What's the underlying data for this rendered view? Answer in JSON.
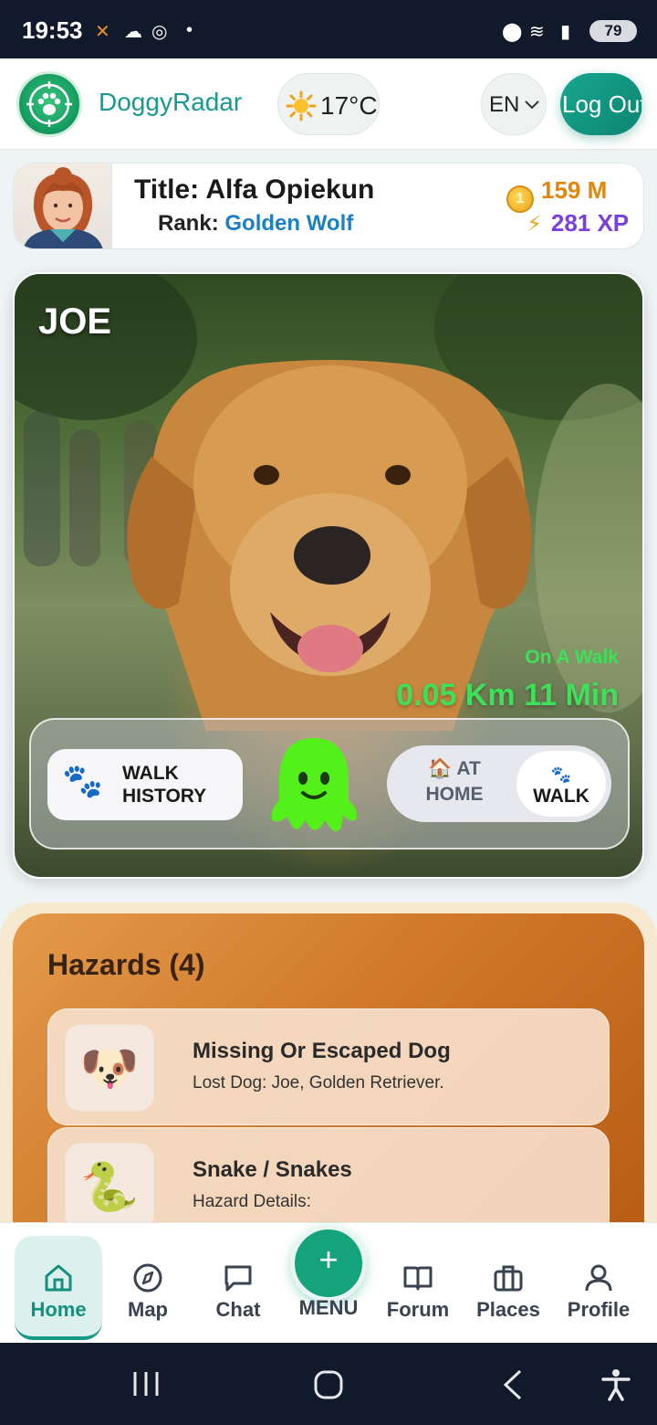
{
  "status_bar": {
    "time": "19:53",
    "battery": "79"
  },
  "header": {
    "app_name": "DoggyRadar",
    "temperature": "17°C",
    "language": "EN",
    "logout_label": "Log Out"
  },
  "user": {
    "title_prefix": "Title:",
    "title_value": "Alfa Opiekun",
    "rank_prefix": "Rank:",
    "rank_value": "Golden Wolf",
    "coins": "159 M",
    "xp": "281 XP"
  },
  "dog": {
    "name": "JOE",
    "status": "On A Walk",
    "stats": "0.05 Km 11 Min",
    "walk_history_label": "WALK HISTORY",
    "at_home_label": "AT HOME",
    "walk_label": "WALK"
  },
  "hazards": {
    "title": "Hazards (4)",
    "items": [
      {
        "name": "Missing Or Escaped Dog",
        "description": "Lost Dog: Joe, Golden Retriever.",
        "icon": "dog-emoji"
      },
      {
        "name": "Snake / Snakes",
        "description": "Hazard Details:",
        "icon": "snake-emoji"
      }
    ]
  },
  "nav": {
    "items": [
      {
        "label": "Home",
        "icon": "home-icon"
      },
      {
        "label": "Map",
        "icon": "compass-icon"
      },
      {
        "label": "Chat",
        "icon": "chat-icon"
      },
      {
        "label": "Forum",
        "icon": "book-icon"
      },
      {
        "label": "Places",
        "icon": "briefcase-icon"
      },
      {
        "label": "Profile",
        "icon": "user-icon"
      }
    ],
    "menu_label": "MENU"
  },
  "colors": {
    "accent": "#15907e",
    "walk_green": "#3ee05a",
    "rank_blue": "#1b7fc4",
    "xp_purple": "#7a3fdc",
    "hazard_orange": "#d07a2a"
  }
}
